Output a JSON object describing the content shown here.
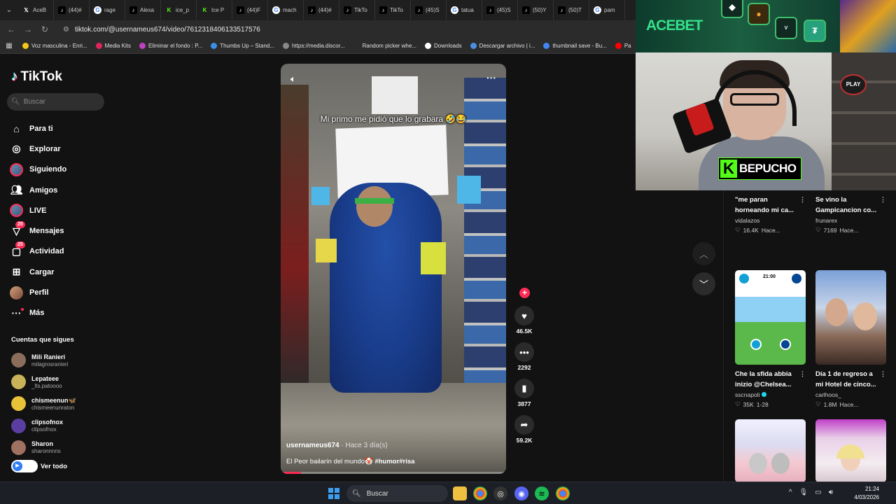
{
  "browser": {
    "tabs": [
      {
        "label": "AceB",
        "icon": "x"
      },
      {
        "label": "(44)#",
        "icon": "tt"
      },
      {
        "label": "rage",
        "icon": "g"
      },
      {
        "label": "Alexa",
        "icon": "tt"
      },
      {
        "label": "ice_p",
        "icon": "k"
      },
      {
        "label": "Ice P",
        "icon": "k"
      },
      {
        "label": "(44)F",
        "icon": "tt"
      },
      {
        "label": "mach",
        "icon": "g"
      },
      {
        "label": "(44)#",
        "icon": "tt"
      },
      {
        "label": "TikTo",
        "icon": "tt"
      },
      {
        "label": "TikTo",
        "icon": "tt"
      },
      {
        "label": "(45)S",
        "icon": "tt"
      },
      {
        "label": "tatua",
        "icon": "g"
      },
      {
        "label": "(45)S",
        "icon": "tt"
      },
      {
        "label": "(50)Y",
        "icon": "tt"
      },
      {
        "label": "(50)T",
        "icon": "tt"
      },
      {
        "label": "pam",
        "icon": "g"
      }
    ],
    "url": "tiktok.com/@usernameus674/video/7612318406133517576",
    "bookmarks": [
      {
        "label": "Voz masculina - Enri...",
        "color": "#f5c518"
      },
      {
        "label": "Media Kits",
        "color": "#e0245e"
      },
      {
        "label": "Eliminar el fondo : P...",
        "color": "#c040c0"
      },
      {
        "label": "Thumbs Up – Stand...",
        "color": "#3a8ee6"
      },
      {
        "label": "https://media.discor...",
        "color": "#888888"
      },
      {
        "label": "Random picker whe...",
        "color": ""
      },
      {
        "label": "Downloads",
        "color": "#ffffff"
      },
      {
        "label": "Descargar archivo | i...",
        "color": "#4a90e2"
      },
      {
        "label": "thumbnail save - Bu...",
        "color": "#4285f4"
      },
      {
        "label": "Pa",
        "color": "#ff0000"
      }
    ]
  },
  "tiktok": {
    "brand": "TikTok",
    "search_placeholder": "Buscar",
    "nav": [
      {
        "label": "Para ti",
        "icon": "home-icon"
      },
      {
        "label": "Explorar",
        "icon": "compass-icon"
      },
      {
        "label": "Siguiendo",
        "icon": "following-avatar-icon"
      },
      {
        "label": "Amigos",
        "icon": "friends-icon"
      },
      {
        "label": "LIVE",
        "icon": "live-icon"
      },
      {
        "label": "Mensajes",
        "icon": "messages-icon",
        "badge": "25"
      },
      {
        "label": "Actividad",
        "icon": "activity-icon",
        "badge": "25"
      },
      {
        "label": "Cargar",
        "icon": "upload-icon"
      },
      {
        "label": "Perfil",
        "icon": "profile-avatar-icon"
      },
      {
        "label": "Más",
        "icon": "more-icon"
      }
    ],
    "following_title": "Cuentas que sigues",
    "following": [
      {
        "name": "Mili Ranieri",
        "handle": "milagrosranieri",
        "color": "#8a6d5a"
      },
      {
        "name": "Lepateee",
        "handle": "_lts.patoooo",
        "color": "#c9b25a"
      },
      {
        "name": "chismeenun🦋",
        "handle": "chismeenunraton",
        "color": "#e8c33a"
      },
      {
        "name": "clipsofnox",
        "handle": "clipsofnox",
        "color": "#5a3fa0"
      },
      {
        "name": "Sharon",
        "handle": "sharonnnns",
        "color": "#a07060"
      }
    ],
    "see_all": "Ver todo",
    "video": {
      "overlay_text": "Mi primo me pidió que lo grabara 🤣😂",
      "username": "usernameus674",
      "posted": "· Hace 3 día(s)",
      "description": "El Peor bailarín del mundo🤡",
      "hashtags": "#humor#risa",
      "progress_pct": 9
    },
    "actions": {
      "likes": "46.5K",
      "comments": "2292",
      "saves": "3877",
      "shares": "59.2K"
    },
    "recommended": [
      {
        "title": "\"me paran horneando mi ca...",
        "author": "vidalazos",
        "likes": "16.4K",
        "date": "Hace...",
        "verified": false
      },
      {
        "title": "Se vino la Gampicancion co...",
        "author": "frunarex",
        "likes": "7169",
        "date": "Hace...",
        "verified": false
      },
      {
        "title": "Che la sfida abbia inizio @Chelsea...",
        "author": "sscnapoli",
        "likes": "35K",
        "date": "1-28",
        "verified": true
      },
      {
        "title": "Día 1 de regreso a mi Hotel de cinco...",
        "author": "carlhoos_",
        "likes": "1.8M",
        "date": "Hace...",
        "verified": false
      }
    ],
    "thumb_score": "21:00"
  },
  "stream_overlay": {
    "sponsor": "ACEBET",
    "streamer": "BEPUCHO",
    "kick_letter": "K",
    "play_sign": "PLAY"
  },
  "taskbar": {
    "search": "Buscar",
    "time": "21:24",
    "date": "4/03/2026"
  }
}
